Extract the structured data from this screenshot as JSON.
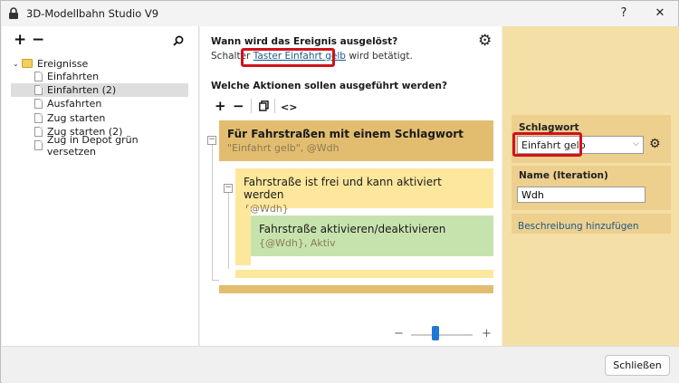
{
  "window": {
    "title": "3D-Modellbahn Studio V9",
    "help_glyph": "?",
    "close_glyph": "✕"
  },
  "left_panel": {
    "add_glyph": "+",
    "remove_glyph": "−",
    "search_glyph": "⚲",
    "root": {
      "toggle": "⌄",
      "label": "Ereignisse"
    },
    "items": [
      {
        "label": "Einfahrten"
      },
      {
        "label": "Einfahrten (2)",
        "selected": true
      },
      {
        "label": "Ausfahrten"
      },
      {
        "label": "Zug starten"
      },
      {
        "label": "Zug starten (2)"
      },
      {
        "label": "Zug in Depot grün versetzen"
      }
    ]
  },
  "trigger": {
    "heading": "Wann wird das Ereignis ausgelöst?",
    "prefix": "Schalter ",
    "link": "Taster Einfahrt gelb",
    "suffix": " wird betätigt."
  },
  "actions": {
    "heading": "Welche Aktionen sollen ausgeführt werden?",
    "toolbar": {
      "add": "+",
      "remove": "−",
      "copy": "⎘",
      "code": "<>"
    },
    "blocks": [
      {
        "title": "Für Fahrstraßen mit einem Schlagwort",
        "sub": "\"Einfahrt gelb\", @Wdh"
      },
      {
        "title": "Fahrstraße ist frei und kann aktiviert werden",
        "sub": "{@Wdh}"
      },
      {
        "title": "Fahrstraße aktivieren/deaktivieren",
        "sub": "{@Wdh}, Aktiv"
      }
    ],
    "collapse_glyph": "−",
    "zoom": {
      "minus": "−",
      "plus": "+",
      "level": 0.4
    }
  },
  "properties": {
    "keyword": {
      "label": "Schlagwort",
      "value": "Einfahrt gelb",
      "chevron": "⌵"
    },
    "name": {
      "label": "Name (Iteration)",
      "value": "Wdh"
    },
    "description_link": "Beschreibung hinzufügen",
    "gear_glyph": "⚙"
  },
  "footer": {
    "close_label": "Schließen"
  },
  "colors": {
    "header_block": "#e2bd70",
    "condition_block": "#fde79c",
    "action_block": "#c7e3ad",
    "right_panel": "#f4dfa6",
    "highlight": "#d0121b"
  }
}
